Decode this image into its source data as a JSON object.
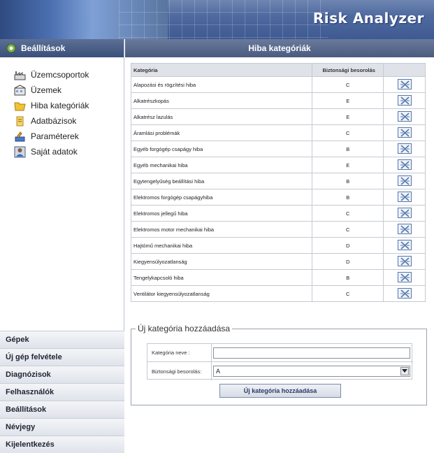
{
  "app": {
    "title": "Risk Analyzer"
  },
  "sidebar": {
    "heading": "Beállítások",
    "items": [
      {
        "label": "Üzemcsoportok",
        "icon": "factory-icon"
      },
      {
        "label": "Üzemek",
        "icon": "building-icon"
      },
      {
        "label": "Hiba kategóriák",
        "icon": "folder-icon"
      },
      {
        "label": "Adatbázisok",
        "icon": "database-icon"
      },
      {
        "label": "Paraméterek",
        "icon": "tools-icon"
      },
      {
        "label": "Saját adatok",
        "icon": "user-icon"
      }
    ]
  },
  "nav": [
    {
      "label": "Gépek"
    },
    {
      "label": "Új gép felvétele"
    },
    {
      "label": "Diagnózisok"
    },
    {
      "label": "Felhasználók"
    },
    {
      "label": "Beállítások"
    },
    {
      "label": "Névjegy"
    },
    {
      "label": "Kijelentkezés"
    }
  ],
  "main": {
    "heading": "Hiba kategóriák",
    "table": {
      "columns": [
        "Kategória",
        "Biztonsági besorolás",
        ""
      ],
      "rows": [
        {
          "name": "Alapozási és rögzítési hiba",
          "level": "C"
        },
        {
          "name": "Alkatrészkopás",
          "level": "E"
        },
        {
          "name": "Alkatrész lazulás",
          "level": "E"
        },
        {
          "name": "Áramlási problémák",
          "level": "C"
        },
        {
          "name": "Egyéb forgógép csapágy hiba",
          "level": "B"
        },
        {
          "name": "Egyéb mechanikai hiba",
          "level": "E"
        },
        {
          "name": "Egytengelyűség beállítási hiba",
          "level": "B"
        },
        {
          "name": "Elektromos forgógép csapágyhiba",
          "level": "B"
        },
        {
          "name": "Elektromos jellegű hiba",
          "level": "C"
        },
        {
          "name": "Elektromos motor mechanikai hiba",
          "level": "C"
        },
        {
          "name": "Hajtómű mechanikai hiba",
          "level": "D"
        },
        {
          "name": "Kiegyensúlyozatlanság",
          "level": "D"
        },
        {
          "name": "Tengelykapcsoló hiba",
          "level": "B"
        },
        {
          "name": "Ventilátor kiegyensúlyozatlanság",
          "level": "C"
        }
      ]
    },
    "add_form": {
      "legend": "Új kategória hozzáadása",
      "name_label": "Kategória neve :",
      "name_value": "",
      "level_label": "Biztonsági besorolás:",
      "level_value": "A",
      "submit_label": "Új kategória hozzáadása"
    }
  },
  "colors": {
    "header": "#4f6a9f",
    "panel_head": "#4b5b7f",
    "delete_icon": "#5577aa"
  }
}
